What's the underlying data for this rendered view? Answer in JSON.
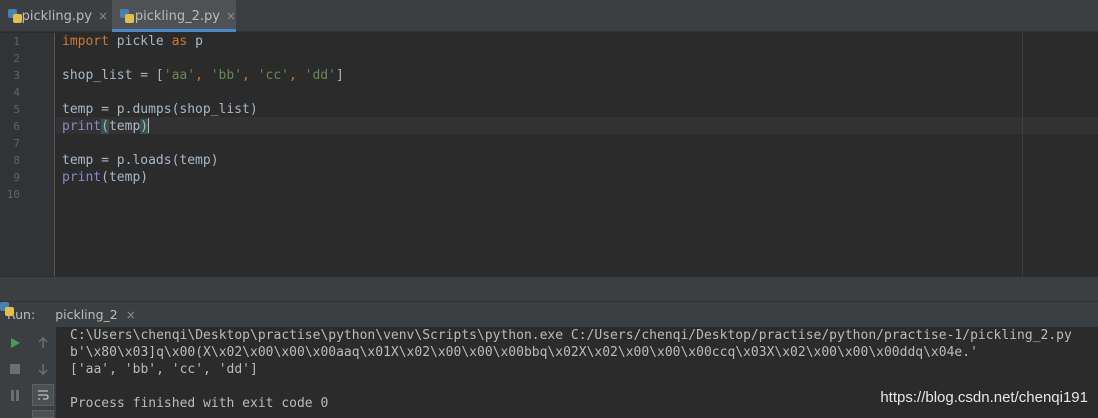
{
  "tabs": [
    {
      "label": "pickling.py",
      "close": "×"
    },
    {
      "label": "pickling_2.py",
      "close": "×"
    }
  ],
  "line_numbers": [
    "1",
    "2",
    "3",
    "4",
    "5",
    "6",
    "7",
    "8",
    "9",
    "10"
  ],
  "code": {
    "l1_kw": "import",
    "l1_rest": " pickle ",
    "l1_as": "as",
    "l1_end": " p",
    "l3_a": "shop_list = [",
    "l3_s1": "'aa'",
    "l3_c1": ", ",
    "l3_s2": "'bb'",
    "l3_c2": ", ",
    "l3_s3": "'cc'",
    "l3_c3": ", ",
    "l3_s4": "'dd'",
    "l3_end": "]",
    "l5": "temp = p.dumps(shop_list)",
    "l6_fn": "print",
    "l6_open": "(",
    "l6_arg": "temp",
    "l6_close": ")",
    "l8": "temp = p.loads(temp)",
    "l9_fn": "print",
    "l9_rest": "(temp)"
  },
  "run": {
    "label": "Run:",
    "tab_label": "pickling_2",
    "tab_close": "×"
  },
  "console": {
    "line1": "C:\\Users\\chenqi\\Desktop\\practise\\python\\venv\\Scripts\\python.exe C:/Users/chenqi/Desktop/practise/python/practise-1/pickling_2.py",
    "line2": "b'\\x80\\x03]q\\x00(X\\x02\\x00\\x00\\x00aaq\\x01X\\x02\\x00\\x00\\x00bbq\\x02X\\x02\\x00\\x00\\x00ccq\\x03X\\x02\\x00\\x00\\x00ddq\\x04e.'",
    "line3": "['aa', 'bb', 'cc', 'dd']",
    "line4": "Process finished with exit code 0"
  },
  "watermark": "https://blog.csdn.net/chenqi191",
  "icons": [
    "python-file-icon",
    "run-icon",
    "stop-icon",
    "pause-icon",
    "up-arrow-icon",
    "down-arrow-icon",
    "soft-wrap-icon"
  ],
  "colors": {
    "keyword": "#cc7832",
    "string": "#6a8759",
    "builtin": "#8888c6",
    "text": "#a9b7c6",
    "accent": "#4a88c7"
  }
}
